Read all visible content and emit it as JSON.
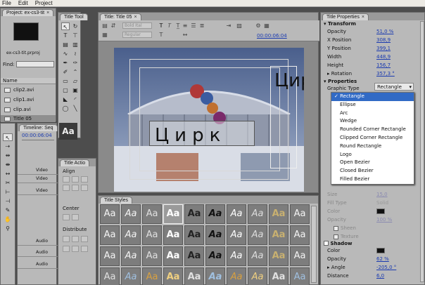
{
  "menubar": {
    "items": [
      "File",
      "Edit",
      "Project"
    ]
  },
  "project": {
    "tab": "Project: ex-cs3-tit",
    "file_name": "ex-cs3-tit.prproj",
    "find_label": "Find:",
    "name_header": "Name",
    "clips": [
      "clip2.avi",
      "clip1.avi",
      "clip.avi",
      "Title 05"
    ]
  },
  "timeline": {
    "tab": "Timeline: Seq",
    "timecode": "00:00:06:04",
    "tracks": [
      "Video",
      "Video",
      "Video",
      "Audio",
      "Audio",
      "Audio"
    ]
  },
  "title_tools": {
    "tab": "Title Tool",
    "sample": "Aa"
  },
  "title_actions": {
    "tab": "Title Actio",
    "align": "Align",
    "center": "Center",
    "distribute": "Distribute"
  },
  "editor": {
    "tab": "Title: Title 05",
    "font_field": "Bold Ital",
    "font_style_field": "Regular",
    "timecode": "00:00:06:04",
    "text_horizontal": "Цирк",
    "text_vertical": "Цирк"
  },
  "styles": {
    "tab": "Title Styles",
    "sample": "Aa",
    "rows": 4,
    "cols": 10
  },
  "properties": {
    "tab": "Title Properties",
    "transform": "Transform",
    "rows": [
      {
        "label": "Opacity",
        "value": "51,0 %"
      },
      {
        "label": "X Position",
        "value": "308,9"
      },
      {
        "label": "Y Position",
        "value": "399,1"
      },
      {
        "label": "Width",
        "value": "448,9"
      },
      {
        "label": "Height",
        "value": "156,7"
      },
      {
        "label": "Rotation",
        "value": "357,3 °"
      }
    ],
    "properties_section": "Properties",
    "graphic_type_label": "Graphic Type",
    "graphic_type_value": "Rectangle",
    "menu_items": [
      "Rectangle",
      "Ellipse",
      "Arc",
      "Wedge",
      "Rounded Corner Rectangle",
      "Clipped Corner Rectangle",
      "Round Rectangle",
      "Logo",
      "Open Bezier",
      "Closed Bezier",
      "Filled Bezier"
    ],
    "menu_selected_index": 0,
    "dim_rows": [
      {
        "label": "Size",
        "value": "15,0"
      },
      {
        "label": "Fill Type",
        "value": "Solid"
      },
      {
        "label": "Color",
        "value": ""
      },
      {
        "label": "Opacity",
        "value": "100 %"
      },
      {
        "label": "Sheen",
        "value": ""
      },
      {
        "label": "Texture",
        "value": ""
      }
    ],
    "shadow": "Shadow",
    "shadow_rows": [
      {
        "label": "Color",
        "value": ""
      },
      {
        "label": "Opacity",
        "value": "62 %"
      },
      {
        "label": "Angle",
        "value": "-205,0 °"
      },
      {
        "label": "Distance",
        "value": "6,0"
      }
    ]
  }
}
